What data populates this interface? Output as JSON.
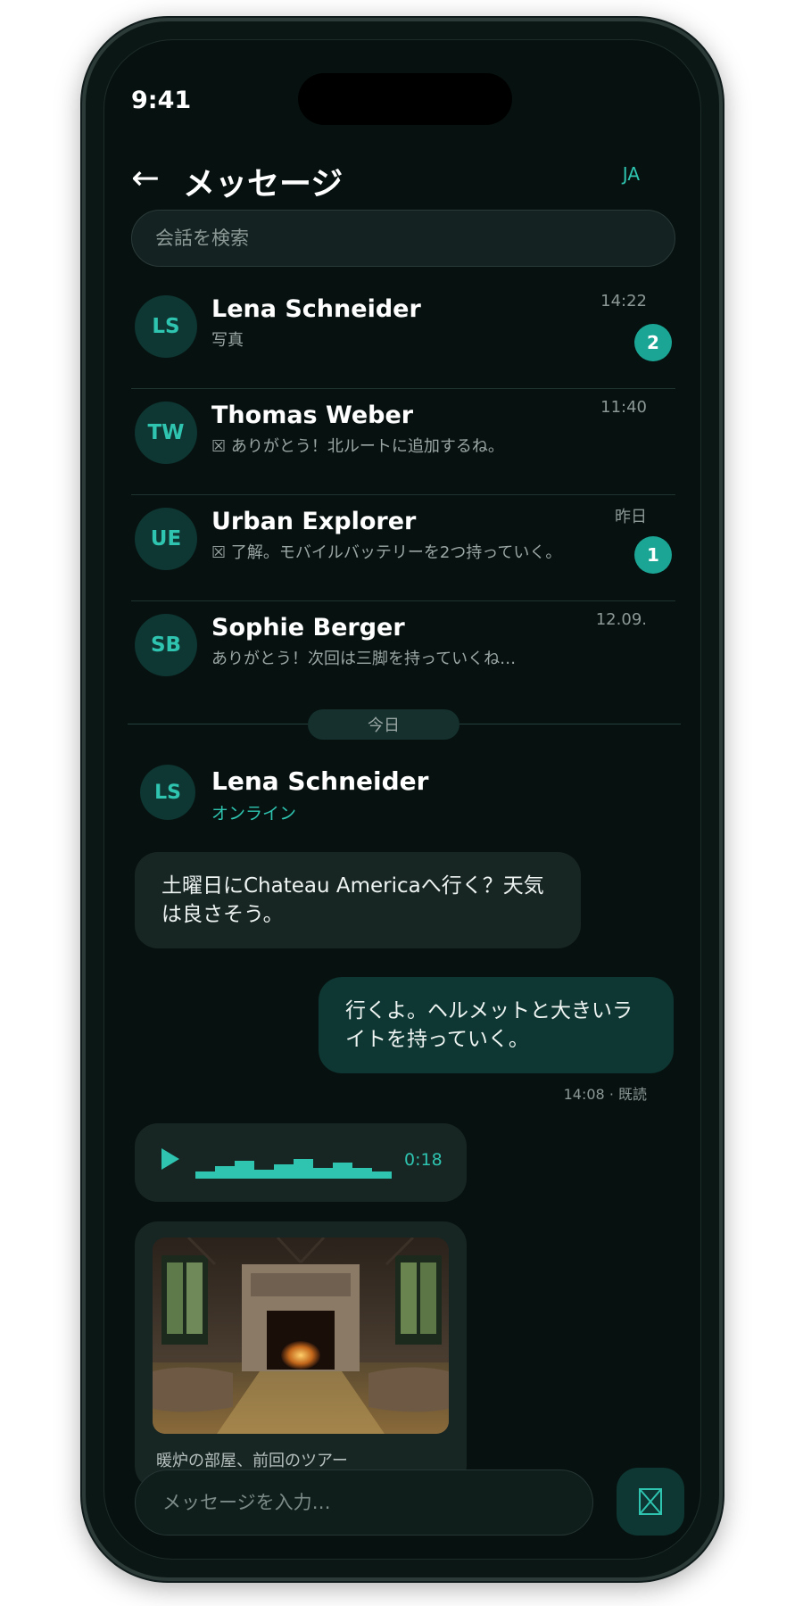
{
  "status_bar": {
    "time": "9:41"
  },
  "header": {
    "title": "メッセージ",
    "lang": "JA"
  },
  "search": {
    "placeholder": "会話を検索"
  },
  "conversations": [
    {
      "initials": "LS",
      "name": "Lena Schneider",
      "preview": "写真",
      "time": "14:22",
      "unread": "2"
    },
    {
      "initials": "TW",
      "name": "Thomas Weber",
      "preview": "☒ ありがとう！北ルートに追加するね。",
      "time": "11:40",
      "unread": ""
    },
    {
      "initials": "UE",
      "name": "Urban Explorer",
      "preview": "☒ 了解。モバイルバッテリーを2つ持っていく。",
      "time": "昨日",
      "unread": "1"
    },
    {
      "initials": "SB",
      "name": "Sophie Berger",
      "preview": "ありがとう！次回は三脚を持っていくね…",
      "time": "12.09.",
      "unread": ""
    }
  ],
  "day_divider": "今日",
  "chat": {
    "initials": "LS",
    "name": "Lena Schneider",
    "status": "オンライン",
    "messages": {
      "incoming_text": "土曜日にChateau Americaへ行く？天気は良さそう。",
      "outgoing_text": "行くよ。ヘルメットと大きいライトを持っていく。",
      "outgoing_meta": "14:08 · 既読",
      "voice_duration": "0:18",
      "photo_caption": "暖炉の部屋、前回のツアー"
    }
  },
  "composer": {
    "placeholder": "メッセージを入力…"
  },
  "colors": {
    "accent": "#2ec4b0",
    "background": "#071210",
    "bubble_out": "#0e3632",
    "bubble_in": "#172523",
    "badge": "#1aa595"
  },
  "icons": {
    "back": "arrow-left-icon",
    "send": "send-icon",
    "play": "play-icon"
  }
}
